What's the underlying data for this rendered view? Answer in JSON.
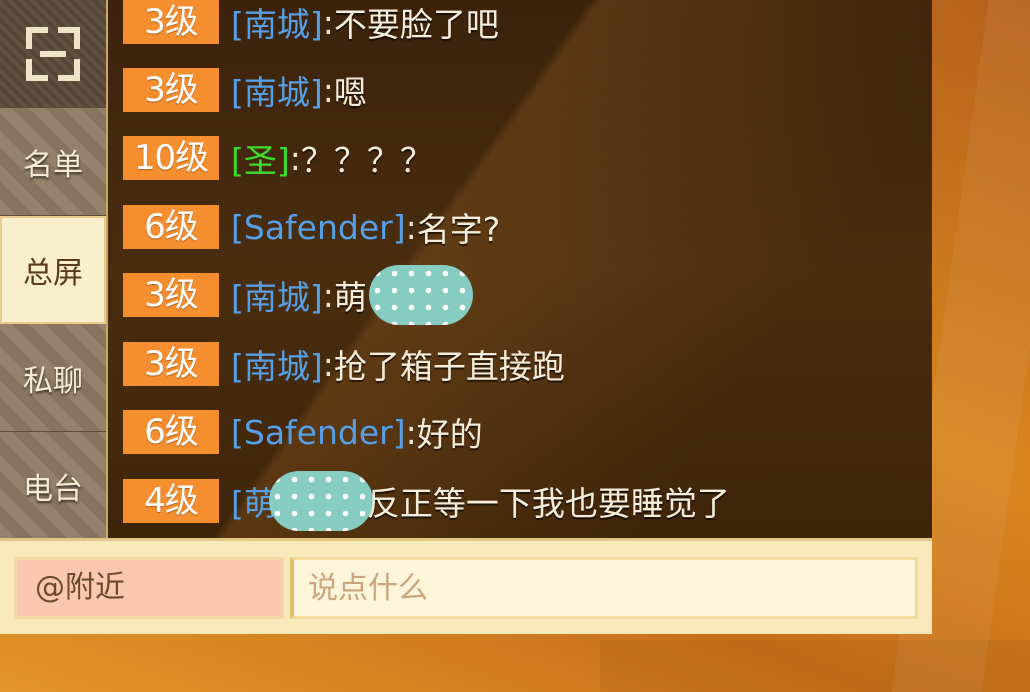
{
  "sidebar": {
    "expand_icon": "expand-icon",
    "items": [
      {
        "label": "名单",
        "active": false
      },
      {
        "label": "总屏",
        "active": true
      },
      {
        "label": "私聊",
        "active": false
      },
      {
        "label": "电台",
        "active": false
      }
    ]
  },
  "chat": {
    "messages": [
      {
        "level": "3级",
        "sender": "[南城]",
        "separator": ":",
        "text": "不要脸了吧"
      },
      {
        "level": "3级",
        "sender": "[南城]",
        "separator": ":",
        "text": "嗯"
      },
      {
        "level": "10级",
        "sender": "[圣]",
        "separator": ":",
        "text": "？？？？"
      },
      {
        "level": "6级",
        "sender": "[Safender]",
        "separator": ":",
        "text": "名字?"
      },
      {
        "level": "3级",
        "sender": "[南城]",
        "separator": ":",
        "text": "萌"
      },
      {
        "level": "3级",
        "sender": "[南城]",
        "separator": ":",
        "text": "抢了箱子直接跑"
      },
      {
        "level": "6级",
        "sender": "[Safender]",
        "separator": ":",
        "text": "好的"
      },
      {
        "level": "4级",
        "sender": "[萌",
        "separator": "",
        "text": "反正等一下我也要睡觉了"
      }
    ]
  },
  "input": {
    "channel": "@附近",
    "placeholder": "说点什么"
  },
  "colors": {
    "level_badge": "#f58e2f",
    "sender_blue": "#56a0e8",
    "sender_green": "#3ddc2a",
    "redaction": "#86ccc2"
  }
}
